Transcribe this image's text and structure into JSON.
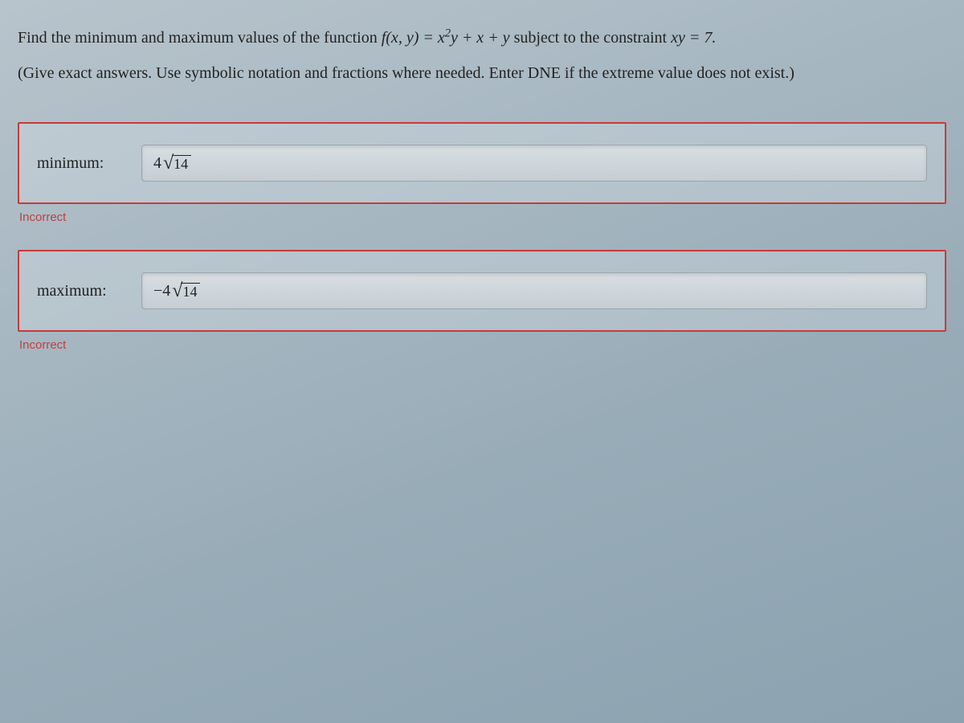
{
  "question": {
    "line1_prefix": "Find the minimum and maximum values of the function ",
    "func_lhs": "f(x, y) = x",
    "func_exp": "2",
    "func_rhs": "y + x + y",
    "line1_mid": " subject to the constraint ",
    "constraint": "xy = 7.",
    "instructions": "(Give exact answers. Use symbolic notation and fractions where needed. Enter DNE if the extreme value does not exist.)"
  },
  "answers": [
    {
      "label": "minimum:",
      "coef": "4",
      "radicand": "14",
      "feedback": "Incorrect"
    },
    {
      "label": "maximum:",
      "coef": "−4",
      "radicand": "14",
      "feedback": "Incorrect"
    }
  ]
}
